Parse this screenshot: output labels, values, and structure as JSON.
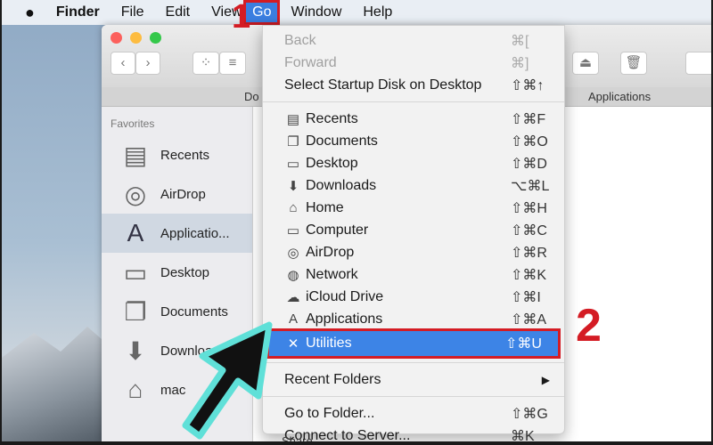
{
  "menubar": {
    "apple": "",
    "items": [
      "Finder",
      "File",
      "Edit",
      "View",
      "Go",
      "Window",
      "Help"
    ]
  },
  "window": {
    "path_left": "Do",
    "path_right": "Applications",
    "sidebar": {
      "heading": "Favorites",
      "items": [
        {
          "label": "Recents",
          "icon": "recents-icon"
        },
        {
          "label": "AirDrop",
          "icon": "airdrop-icon"
        },
        {
          "label": "Applicatio...",
          "icon": "applications-icon",
          "selected": true
        },
        {
          "label": "Desktop",
          "icon": "desktop-icon"
        },
        {
          "label": "Documents",
          "icon": "documents-icon"
        },
        {
          "label": "Downloads",
          "icon": "downloads-icon"
        },
        {
          "label": "mac",
          "icon": "home-icon"
        }
      ]
    },
    "footer_partial": "Share"
  },
  "go_menu": {
    "group1": [
      {
        "label": "Back",
        "shortcut": "⌘[",
        "disabled": true
      },
      {
        "label": "Forward",
        "shortcut": "⌘]",
        "disabled": true
      },
      {
        "label": "Select Startup Disk on Desktop",
        "shortcut": "⇧⌘↑"
      }
    ],
    "group2": [
      {
        "label": "Recents",
        "shortcut": "⇧⌘F",
        "icon": "▤"
      },
      {
        "label": "Documents",
        "shortcut": "⇧⌘O",
        "icon": "❐"
      },
      {
        "label": "Desktop",
        "shortcut": "⇧⌘D",
        "icon": "▭"
      },
      {
        "label": "Downloads",
        "shortcut": "⌥⌘L",
        "icon": "⬇"
      },
      {
        "label": "Home",
        "shortcut": "⇧⌘H",
        "icon": "⌂"
      },
      {
        "label": "Computer",
        "shortcut": "⇧⌘C",
        "icon": "▭"
      },
      {
        "label": "AirDrop",
        "shortcut": "⇧⌘R",
        "icon": "◎"
      },
      {
        "label": "Network",
        "shortcut": "⇧⌘K",
        "icon": "◍"
      },
      {
        "label": "iCloud Drive",
        "shortcut": "⇧⌘I",
        "icon": "☁"
      },
      {
        "label": "Applications",
        "shortcut": "⇧⌘A",
        "icon": "A"
      }
    ],
    "highlighted": {
      "label": "Utilities",
      "shortcut": "⇧⌘U",
      "icon": "✕"
    },
    "recent_folders": {
      "label": "Recent Folders",
      "submenu": "▶"
    },
    "group4": [
      {
        "label": "Go to Folder...",
        "shortcut": "⇧⌘G"
      },
      {
        "label": "Connect to Server...",
        "shortcut": "⌘K"
      }
    ]
  },
  "annotations": {
    "step1": "1",
    "step2": "2"
  },
  "colors": {
    "highlight": "#3d84e6",
    "annotation_red": "#d41c24",
    "arrow_outline": "#5fe0d8"
  }
}
